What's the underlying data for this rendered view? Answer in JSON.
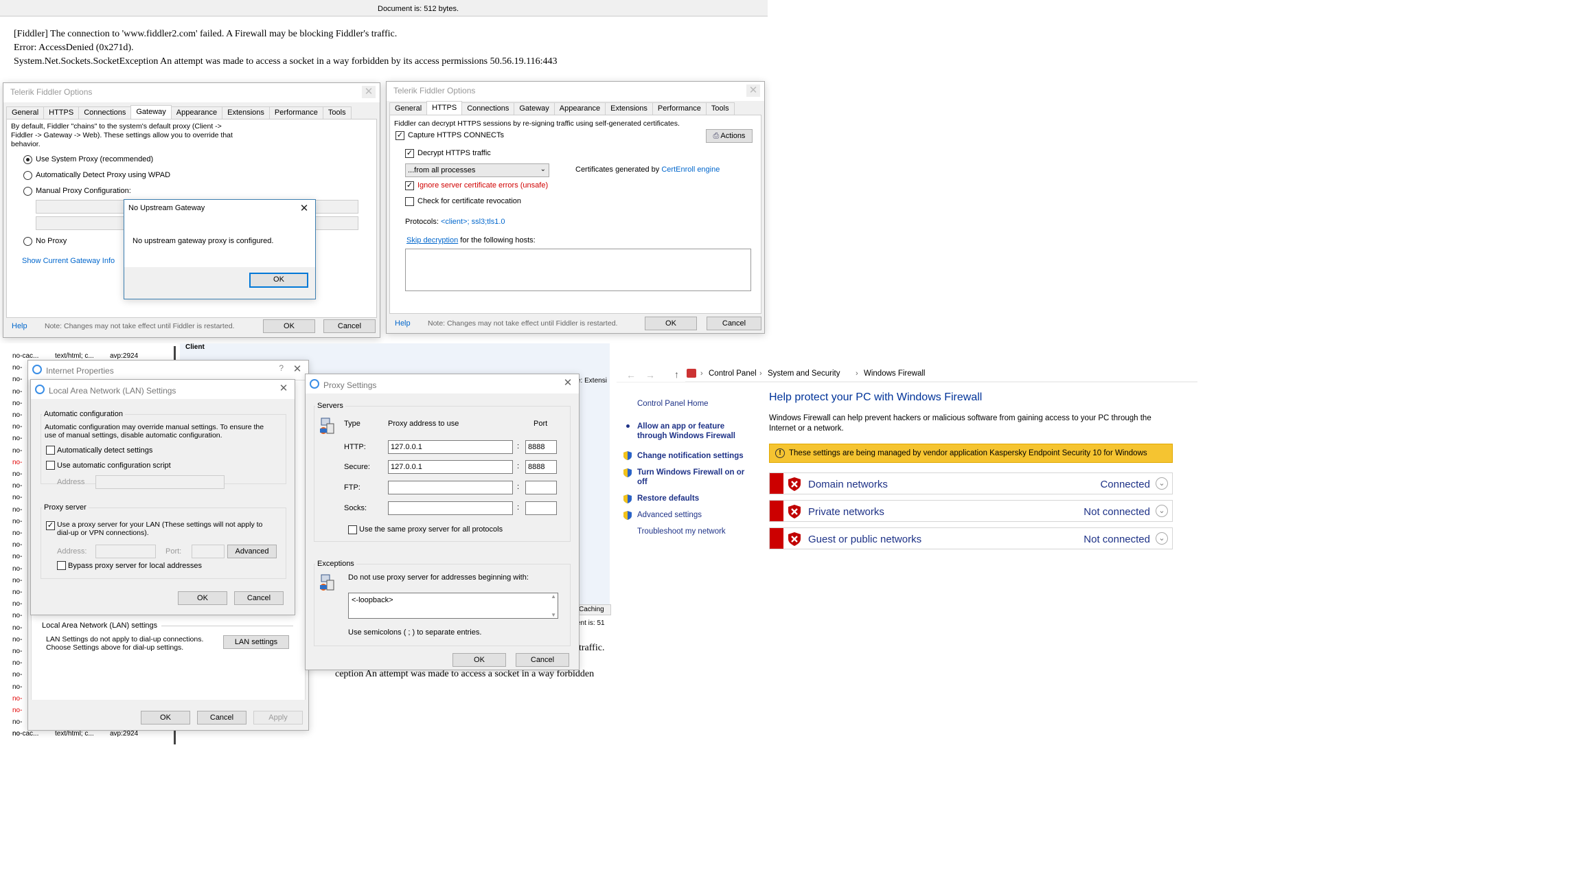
{
  "browser": {
    "doc_size": "Document is: 512 bytes.",
    "error_lines": [
      "[Fiddler] The connection to 'www.fiddler2.com' failed. A Firewall may be blocking Fiddler's traffic.",
      "Error: AccessDenied (0x271d).",
      "System.Net.Sockets.SocketException An attempt was made to access a socket in a way forbidden by its access permissions 50.56.19.116:443"
    ],
    "bg_fragments": [
      "traffic.",
      "ception An attempt was made to access a socket in a way forbidden"
    ]
  },
  "fiddler_gateway": {
    "title": "Telerik Fiddler Options",
    "tabs": [
      "General",
      "HTTPS",
      "Connections",
      "Gateway",
      "Appearance",
      "Extensions",
      "Performance",
      "Tools"
    ],
    "active_tab": "Gateway",
    "description": "By default, Fiddler \"chains\" to the system's default proxy (Client -> Fiddler -> Gateway -> Web). These settings allow you to override that behavior.",
    "options": [
      "Use System Proxy (recommended)",
      "Automatically Detect Proxy using WPAD",
      "Manual Proxy Configuration:",
      "No Proxy"
    ],
    "selected_option": "Use System Proxy (recommended)",
    "gateway_link": "Show Current Gateway Info",
    "help": "Help",
    "note": "Note: Changes may not take effect until Fiddler is restarted.",
    "ok": "OK",
    "cancel": "Cancel"
  },
  "gateway_dialog": {
    "title": "No Upstream Gateway",
    "message": "No upstream gateway proxy is configured.",
    "ok": "OK"
  },
  "fiddler_https": {
    "title": "Telerik Fiddler Options",
    "tabs": [
      "General",
      "HTTPS",
      "Connections",
      "Gateway",
      "Appearance",
      "Extensions",
      "Performance",
      "Tools"
    ],
    "active_tab": "HTTPS",
    "description": "Fiddler can decrypt HTTPS sessions by re-signing traffic using self-generated certificates.",
    "capture": "Capture HTTPS CONNECTs",
    "decrypt": "Decrypt HTTPS traffic",
    "process_select": "...from all processes",
    "cert_prefix": "Certificates generated by ",
    "cert_engine": "CertEnroll engine",
    "ignore_errors": "Ignore server certificate errors (unsafe)",
    "revocation": "Check for certificate revocation",
    "protocols_label": "Protocols: ",
    "protocols_value": "<client>; ssl3;tls1.0",
    "skip_link": "Skip decryption",
    "skip_rest": " for the following hosts:",
    "actions": "Actions",
    "help": "Help",
    "note": "Note: Changes may not take effect until Fiddler is restarted.",
    "ok": "OK",
    "cancel": "Cancel"
  },
  "session_list": {
    "rows": [
      "no-cac",
      "no-",
      "no-",
      "no-",
      "no-",
      "no-",
      "no-",
      "no-",
      "no-",
      "no-",
      "no-",
      "no-",
      "no-",
      "no-",
      "no-",
      "no-",
      "no-",
      "no-",
      "no-",
      "no-",
      "no-",
      "no-",
      "no-",
      "no-",
      "no-",
      "no-",
      "no-",
      "no-",
      "no-",
      "no-",
      "no-",
      "no-",
      "no-"
    ],
    "red_rows": [
      9,
      29,
      30
    ],
    "first": {
      "col1": "no-cac...",
      "col2": "text/html; c...",
      "col3": "avp:2924"
    },
    "last": {
      "col1": "no-cac...",
      "col2": "text/html; c...",
      "col3": "avp:2924"
    },
    "client_label": "Client",
    "extens": "e: Extensi",
    "caching": "Caching",
    "ent_is": "ent is: 51"
  },
  "internet_props": {
    "title": "Internet Properties",
    "help_mark": "?",
    "lan_group": "Local Area Network (LAN) settings",
    "lan_text1": "LAN Settings do not apply to dial-up connections.",
    "lan_text2": "Choose Settings above for dial-up settings.",
    "lan_btn": "LAN settings",
    "ok": "OK",
    "cancel": "Cancel",
    "apply": "Apply"
  },
  "lan_settings": {
    "title": "Local Area Network (LAN) Settings",
    "auto_group": "Automatic configuration",
    "auto_desc1": "Automatic configuration may override manual settings.  To ensure the",
    "auto_desc2": "use of manual settings, disable automatic configuration.",
    "auto_detect": "Automatically detect settings",
    "auto_script": "Use automatic configuration script",
    "address_label": "Address",
    "proxy_group": "Proxy server",
    "use_proxy1": "Use a proxy server for your LAN (These settings will not apply to",
    "use_proxy2": "dial-up or VPN connections).",
    "addr_label": "Address:",
    "port_label": "Port:",
    "advanced": "Advanced",
    "bypass": "Bypass proxy server for local addresses",
    "ok": "OK",
    "cancel": "Cancel"
  },
  "proxy_settings": {
    "title": "Proxy Settings",
    "servers_group": "Servers",
    "type_hdr": "Type",
    "addr_hdr": "Proxy address to use",
    "port_hdr": "Port",
    "rows": [
      {
        "label": "HTTP:",
        "address": "127.0.0.1",
        "port": "8888"
      },
      {
        "label": "Secure:",
        "address": "127.0.0.1",
        "port": "8888"
      },
      {
        "label": "FTP:",
        "address": "",
        "port": ""
      },
      {
        "label": "Socks:",
        "address": "",
        "port": ""
      }
    ],
    "same_proxy": "Use the same proxy server for all protocols",
    "exceptions_group": "Exceptions",
    "exceptions_desc": "Do not use proxy server for addresses beginning with:",
    "exceptions_value": "<-loopback>",
    "semicolon_note": "Use semicolons ( ; ) to separate entries.",
    "ok": "OK",
    "cancel": "Cancel"
  },
  "firewall": {
    "breadcrumb": [
      "Control Panel",
      "System and Security",
      "Windows Firewall"
    ],
    "sidebar_home": "Control Panel Home",
    "sidebar": [
      "Allow an app or feature through Windows Firewall",
      "Change notification settings",
      "Turn Windows Firewall on or off",
      "Restore defaults",
      "Advanced settings",
      "Troubleshoot my network"
    ],
    "heading": "Help protect your PC with Windows Firewall",
    "description": "Windows Firewall can help prevent hackers or malicious software from gaining access to your PC through the Internet or a network.",
    "banner": "These settings are being managed by vendor application Kaspersky Endpoint Security 10 for Windows",
    "networks": [
      {
        "name": "Domain networks",
        "status": "Connected"
      },
      {
        "name": "Private networks",
        "status": "Not connected"
      },
      {
        "name": "Guest or public networks",
        "status": "Not connected"
      }
    ],
    "colors": {
      "banner_bg": "#f5c431",
      "alert_red": "#c00000",
      "link_blue": "#1e3287",
      "heading_blue": "#003399"
    }
  }
}
